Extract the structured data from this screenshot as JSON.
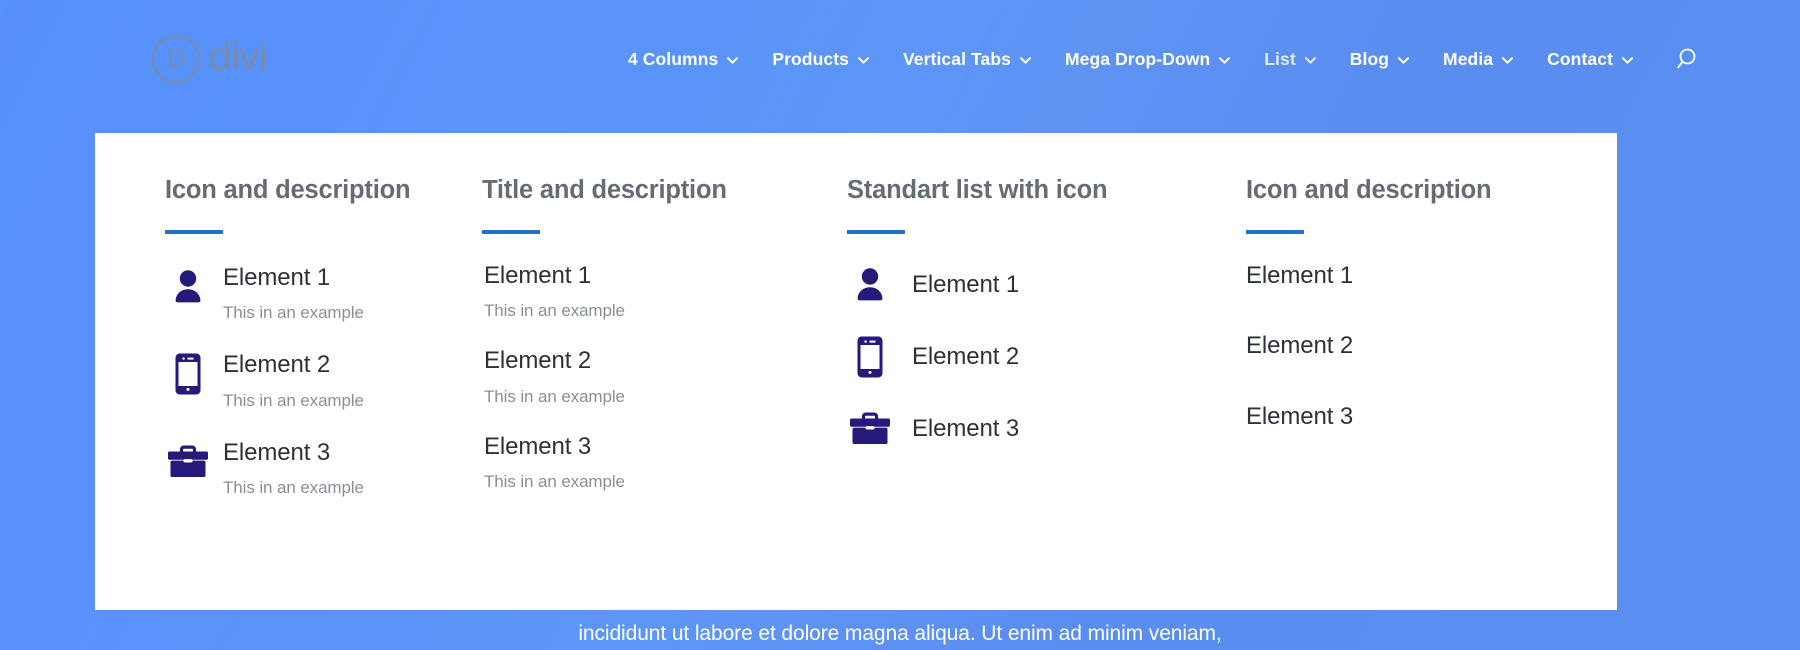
{
  "brand": {
    "mark_letter": "D",
    "name": "divi"
  },
  "nav": {
    "items": [
      {
        "label": "4 Columns",
        "has_chevron": true,
        "dim": false
      },
      {
        "label": "Products",
        "has_chevron": true,
        "dim": false
      },
      {
        "label": "Vertical Tabs",
        "has_chevron": true,
        "dim": false
      },
      {
        "label": "Mega Drop-Down",
        "has_chevron": true,
        "dim": false
      },
      {
        "label": "List",
        "has_chevron": true,
        "dim": true
      },
      {
        "label": "Blog",
        "has_chevron": true,
        "dim": false
      },
      {
        "label": "Media",
        "has_chevron": true,
        "dim": false
      },
      {
        "label": "Contact",
        "has_chevron": true,
        "dim": false
      }
    ],
    "search_icon": "search-icon"
  },
  "colors": {
    "page_background": "#5b92f5",
    "card_background": "#ffffff",
    "accent_rule": "#1f73c4",
    "icon_navy": "#251a7a",
    "heading_gray": "#666c73",
    "body_dark": "#2c3238",
    "desc_gray": "#8a8f95",
    "brand_gray": "#7b8aa5"
  },
  "columns": [
    {
      "title": "Icon and description",
      "layout": "icon-title-desc",
      "items": [
        {
          "icon": "user-icon",
          "title": "Element 1",
          "desc": "This in an example"
        },
        {
          "icon": "mobile-icon",
          "title": "Element 2",
          "desc": "This in an example"
        },
        {
          "icon": "briefcase-icon",
          "title": "Element 3",
          "desc": "This in an example"
        }
      ]
    },
    {
      "title": "Title and description",
      "layout": "title-desc",
      "items": [
        {
          "icon": null,
          "title": "Element 1",
          "desc": "This in an example"
        },
        {
          "icon": null,
          "title": "Element 2",
          "desc": "This in an example"
        },
        {
          "icon": null,
          "title": "Element 3",
          "desc": "This in an example"
        }
      ]
    },
    {
      "title": "Standart list with icon",
      "layout": "icon-title",
      "items": [
        {
          "icon": "user-icon",
          "title": "Element 1",
          "desc": null
        },
        {
          "icon": "mobile-icon",
          "title": "Element 2",
          "desc": null
        },
        {
          "icon": "briefcase-icon",
          "title": "Element 3",
          "desc": null
        }
      ]
    },
    {
      "title": "Icon and description",
      "layout": "title-only",
      "items": [
        {
          "icon": null,
          "title": "Element 1",
          "desc": null
        },
        {
          "icon": null,
          "title": "Element 2",
          "desc": null
        },
        {
          "icon": null,
          "title": "Element 3",
          "desc": null
        }
      ]
    }
  ],
  "bottom": {
    "text": "incididunt ut labore et dolore magna aliqua. Ut enim ad minim veniam,"
  }
}
